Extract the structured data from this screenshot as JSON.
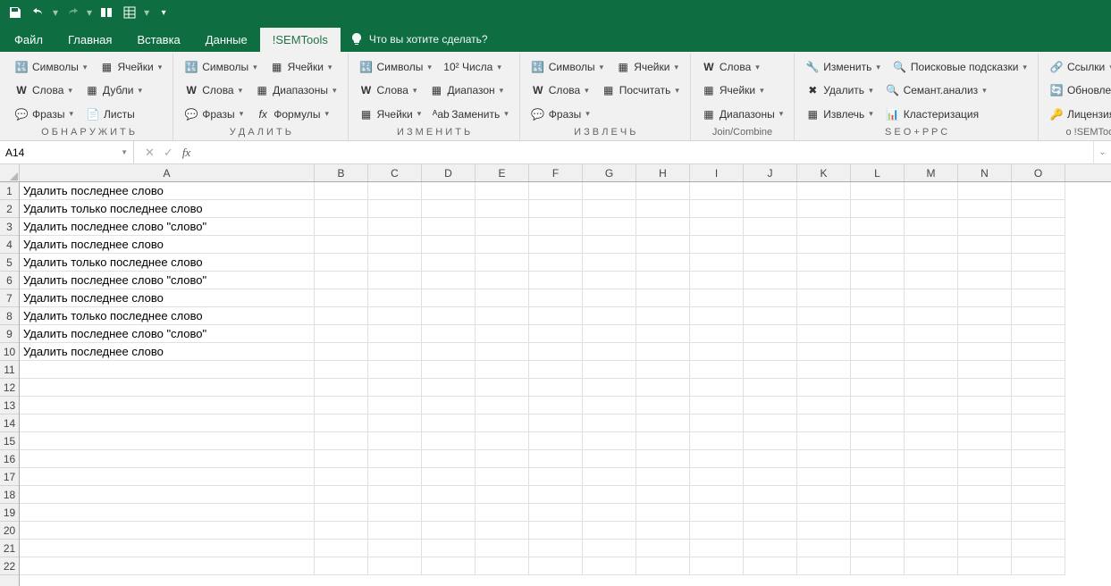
{
  "qat": {
    "save": "save",
    "undo": "undo",
    "redo": "redo"
  },
  "tabs": {
    "file": "Файл",
    "home": "Главная",
    "insert": "Вставка",
    "data": "Данные",
    "semtools": "!SEMTools",
    "tell_me": "Что вы хотите сделать?"
  },
  "ribbon": {
    "discover": {
      "label": "О Б Н А Р У Ж И Т Ь",
      "symbols": "Символы",
      "cells": "Ячейки",
      "words": "Слова",
      "duplicates": "Дубли",
      "phrases": "Фразы",
      "sheets": "Листы"
    },
    "delete": {
      "label": "У Д А Л И Т Ь",
      "symbols": "Символы",
      "cells": "Ячейки",
      "words": "Слова",
      "ranges": "Диапазоны",
      "phrases": "Фразы",
      "formulas": "Формулы"
    },
    "change": {
      "label": "И З М Е Н И Т Ь",
      "symbols": "Символы",
      "numbers": "Числа",
      "words": "Слова",
      "range": "Диапазон",
      "cells": "Ячейки",
      "replace": "Заменить"
    },
    "extract": {
      "label": "И З В Л Е Ч Ь",
      "symbols": "Символы",
      "cells": "Ячейки",
      "words": "Слова",
      "count": "Посчитать",
      "phrases": "Фразы"
    },
    "join": {
      "label": "Join/Combine",
      "words": "Слова",
      "cells": "Ячейки",
      "ranges": "Диапазоны"
    },
    "seo": {
      "label": "S E O + P P C",
      "change": "Изменить",
      "search_hints": "Поисковые подсказки",
      "delete": "Удалить",
      "semantic": "Семант.анализ",
      "extract": "Извлечь",
      "cluster": "Кластеризация"
    },
    "about": {
      "label": "о !SEMTools",
      "links": "Ссылки",
      "update": "Обновление",
      "license": "Лицензия"
    }
  },
  "namebox": "A14",
  "cells": {
    "A1": "Удалить последнее слово",
    "A2": "Удалить только последнее слово",
    "A3": "Удалить последнее слово \"слово\"",
    "A4": "Удалить последнее слово",
    "A5": "Удалить только последнее слово",
    "A6": "Удалить последнее слово \"слово\"",
    "A7": "Удалить последнее слово",
    "A8": "Удалить только последнее слово",
    "A9": "Удалить последнее слово \"слово\"",
    "A10": "Удалить последнее слово"
  },
  "columns": [
    "A",
    "B",
    "C",
    "D",
    "E",
    "F",
    "G",
    "H",
    "I",
    "J",
    "K",
    "L",
    "M",
    "N",
    "O"
  ],
  "rows": [
    1,
    2,
    3,
    4,
    5,
    6,
    7,
    8,
    9,
    10,
    11,
    12,
    13,
    14,
    15,
    16,
    17,
    18,
    19,
    20,
    21,
    22
  ]
}
